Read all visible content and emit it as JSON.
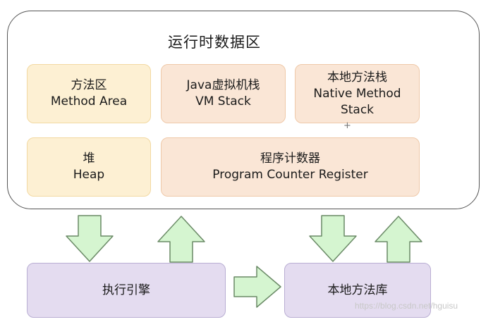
{
  "runtime": {
    "title": "运行时数据区"
  },
  "boxes": {
    "method_area": {
      "line1": "方法区",
      "line2": "Method Area"
    },
    "vm_stack": {
      "line1": "Java虚拟机栈",
      "line2": "VM Stack"
    },
    "native_stack": {
      "line1": "本地方法栈",
      "line2": "Native Method",
      "line3": "Stack"
    },
    "heap": {
      "line1": "堆",
      "line2": "Heap"
    },
    "pc_register": {
      "line1": "程序计数器",
      "line2": "Program Counter Register"
    }
  },
  "bottom": {
    "execution_engine": "执行引擎",
    "native_library": "本地方法库"
  },
  "plus_mark": "+",
  "watermark": "https://blog.csdn.net/hguisu",
  "colors": {
    "yellow_fill": "#fdf0d3",
    "orange_fill": "#fae6d6",
    "purple_fill": "#e4dcf0",
    "arrow_fill": "#d5f5d0",
    "arrow_stroke": "#6a8a66"
  }
}
